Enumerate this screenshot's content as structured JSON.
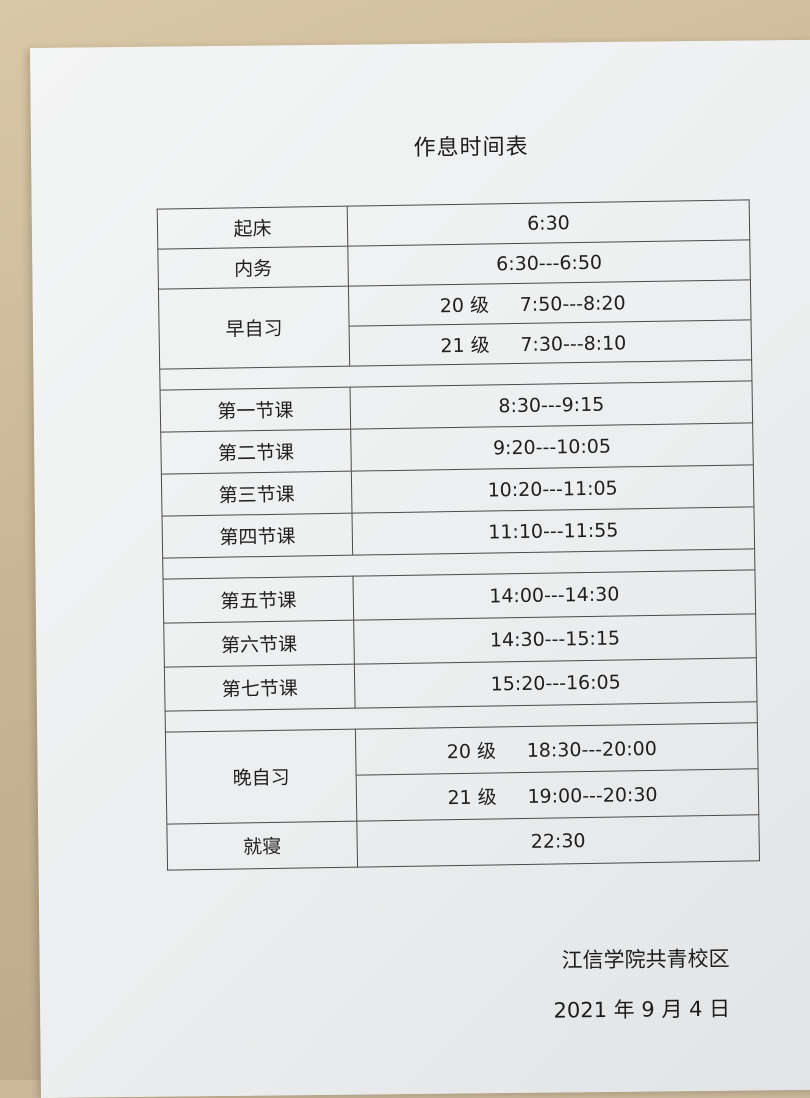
{
  "title": "作息时间表",
  "schedule": {
    "wake": {
      "label": "起床",
      "time": "6:30"
    },
    "chores": {
      "label": "内务",
      "time": "6:30---6:50"
    },
    "morning_study": {
      "label": "早自习",
      "rows": [
        {
          "grade": "20 级",
          "time": "7:50---8:20"
        },
        {
          "grade": "21 级",
          "time": "7:30---8:10"
        }
      ]
    },
    "classes_am": [
      {
        "label": "第一节课",
        "time": "8:30---9:15"
      },
      {
        "label": "第二节课",
        "time": "9:20---10:05"
      },
      {
        "label": "第三节课",
        "time": "10:20---11:05"
      },
      {
        "label": "第四节课",
        "time": "11:10---11:55"
      }
    ],
    "classes_pm": [
      {
        "label": "第五节课",
        "time": "14:00---14:30"
      },
      {
        "label": "第六节课",
        "time": "14:30---15:15"
      },
      {
        "label": "第七节课",
        "time": "15:20---16:05"
      }
    ],
    "evening_study": {
      "label": "晚自习",
      "rows": [
        {
          "grade": "20 级",
          "time": "18:30---20:00"
        },
        {
          "grade": "21 级",
          "time": "19:00---20:30"
        }
      ]
    },
    "sleep": {
      "label": "就寝",
      "time": "22:30"
    }
  },
  "footer": {
    "school": "江信学院共青校区",
    "date": "2021 年 9 月 4 日"
  }
}
